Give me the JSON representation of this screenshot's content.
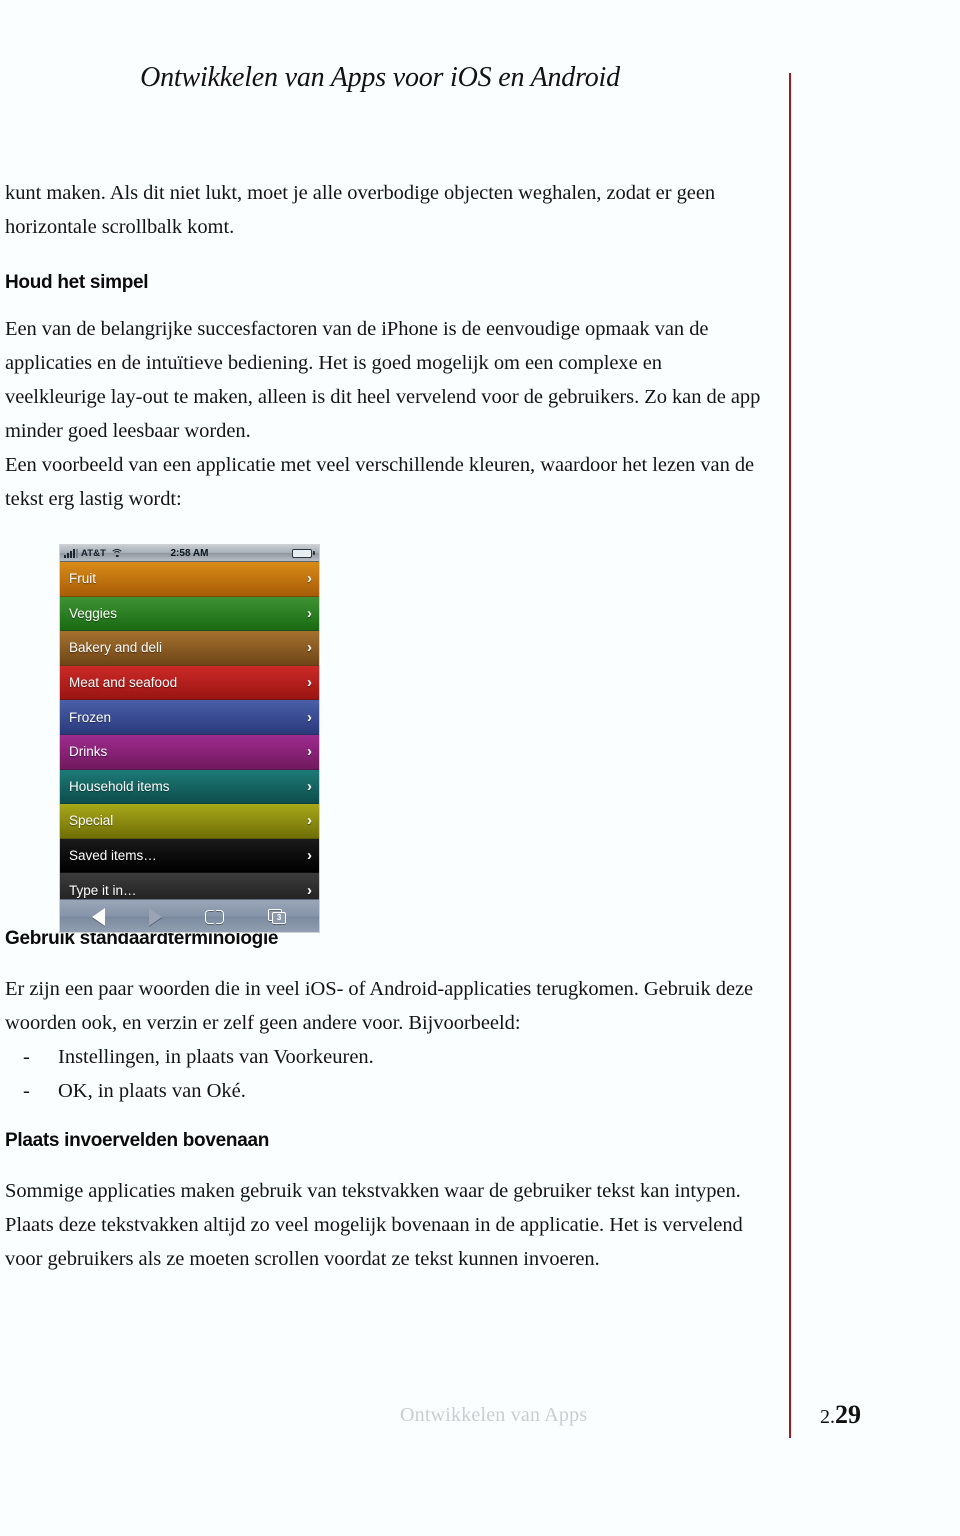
{
  "header": {
    "title": "Ontwikkelen van Apps voor iOS en Android"
  },
  "colors": {
    "margin_rule": "#9c1c20",
    "page_background": "#fbfeff",
    "footer_text": "#c9cdd0",
    "body_text": "#141414"
  },
  "content": {
    "intro_paragraph": "kunt maken. Als dit niet lukt, moet je alle overbodige objecten weghalen, zodat er geen horizontale scrollbalk komt.",
    "section_1": {
      "heading": "Houd het simpel",
      "paragraph_1": "Een van de belangrijke succesfactoren van de iPhone is de eenvoudige opmaak van de applicaties en de intuïtieve bediening. Het is goed mogelijk om een complexe en veelkleurige lay-out te maken, alleen is dit heel vervelend voor de gebruikers. Zo kan de app minder goed leesbaar worden.",
      "paragraph_2": "Een voorbeeld van een applicatie met veel verschillende kleuren, waardoor het lezen van de tekst erg lastig wordt:"
    },
    "section_2": {
      "heading": "Gebruik standaardterminologie",
      "paragraph_1": "Er zijn een paar woorden die in veel iOS- of Android-applicaties terugkomen. Gebruik deze woorden ook, en verzin er zelf geen andere voor. Bijvoorbeeld:",
      "bullets": [
        {
          "marker": "-",
          "text": "Instellingen, in plaats van Voorkeuren."
        },
        {
          "marker": "-",
          "text": "OK, in plaats van Oké."
        }
      ]
    },
    "section_3": {
      "heading": "Plaats invoervelden bovenaan",
      "paragraph_1": "Sommige applicaties maken gebruik van tekstvakken waar de gebruiker tekst kan intypen. Plaats deze tekstvakken altijd zo veel mogelijk bovenaan in de applicatie. Het is vervelend voor gebruikers als ze moeten scrollen voordat ze tekst kunnen invoeren."
    }
  },
  "figure": {
    "caption": "",
    "status_bar": {
      "carrier": "AT&T",
      "time": "2:58 AM",
      "signal_icon": "signal-bars-icon",
      "wifi_icon": "wifi-icon",
      "battery_icon": "battery-icon"
    },
    "list_rows": [
      {
        "label": "Fruit",
        "color_top": "#d98c18",
        "color_bottom": "#a85c07",
        "chevron": "›"
      },
      {
        "label": "Veggies",
        "color_top": "#3f9334",
        "color_bottom": "#196a12",
        "chevron": "›"
      },
      {
        "label": "Bakery and deli",
        "color_top": "#a5712f",
        "color_bottom": "#6f4517",
        "chevron": "›"
      },
      {
        "label": "Meat and seafood",
        "color_top": "#cc2a27",
        "color_bottom": "#9a1512",
        "chevron": "›"
      },
      {
        "label": "Frozen",
        "color_top": "#4a5fa8",
        "color_bottom": "#2a3a7c",
        "chevron": "›"
      },
      {
        "label": "Drinks",
        "color_top": "#9e2b8e",
        "color_bottom": "#72195f",
        "chevron": "›"
      },
      {
        "label": "Household items",
        "color_top": "#1d7a77",
        "color_bottom": "#0d4e4c",
        "chevron": "›"
      },
      {
        "label": "Special",
        "color_top": "#a8a81a",
        "color_bottom": "#6f6f07",
        "chevron": "›"
      },
      {
        "label": "Saved items…",
        "color_top": "#1a1a1a",
        "color_bottom": "#000000",
        "chevron": "›"
      },
      {
        "label": "Type it in…",
        "color_top": "#3c3c3c",
        "color_bottom": "#1c1c1c",
        "chevron": "›"
      }
    ],
    "toolbar": {
      "back_icon": "back-arrow-icon",
      "forward_icon": "forward-arrow-icon",
      "bookmarks_icon": "bookmarks-book-icon",
      "tabs_icon": "tabs-icon",
      "tabs_count": "3"
    }
  },
  "footer": {
    "book_title": "Ontwikkelen van Apps",
    "chapter_prefix": "2.",
    "page_number": "29"
  }
}
